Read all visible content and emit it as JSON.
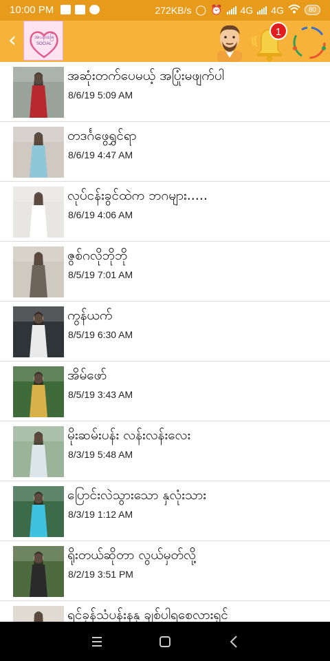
{
  "status_bar": {
    "time": "10:00 PM",
    "speed": "272KB/s",
    "network_1": "4G",
    "network_2": "4G",
    "battery": "80"
  },
  "app_bar": {
    "logo_title": "အပန်းဖြေ",
    "logo_subtitle": "SOCIAL",
    "notification_count": "1"
  },
  "feed": [
    {
      "title": "အဆုံးတက်ပေမယ့် အပြုံးမဖျက်ပါ",
      "time": "8/6/19 5:09 AM",
      "thumb": {
        "bg": "#9aa39a",
        "figure": "#b8282f"
      }
    },
    {
      "title": "တဒင်္ဂဖွေရွှင်ရာ",
      "time": "8/6/19 4:47 AM",
      "thumb": {
        "bg": "#cfc9c2",
        "figure": "#8fc6d8"
      }
    },
    {
      "title": "လုပ်ငန်းခွင်ထဲက ဘဂများ.....",
      "time": "8/6/19 4:06 AM",
      "thumb": {
        "bg": "#e8e6e2",
        "figure": "#ffffff"
      }
    },
    {
      "title": "ဇွစ်ဂလိုဘိုဘို",
      "time": "8/5/19 7:01 AM",
      "thumb": {
        "bg": "#cfcac0",
        "figure": "#6e655a"
      }
    },
    {
      "title": "ကွန်ယက်",
      "time": "8/5/19 6:30 AM",
      "thumb": {
        "bg": "#2f3438",
        "figure": "#e9e9e9"
      }
    },
    {
      "title": "အိမ်ဖော်",
      "time": "8/5/19 3:43 AM",
      "thumb": {
        "bg": "#3f6a3a",
        "figure": "#d9b14a"
      }
    },
    {
      "title": "မိုးဆမ်းပန်း လန်းလန်းလေး",
      "time": "8/3/19 5:48 AM",
      "thumb": {
        "bg": "#9ab49a",
        "figure": "#dce6ea"
      }
    },
    {
      "title": "ပြောင်းလဲသွားသော နှလုံးသား",
      "time": "8/3/19 1:12 AM",
      "thumb": {
        "bg": "#3c6b4a",
        "figure": "#3ec2e0"
      }
    },
    {
      "title": "ရိုးတယ်ဆိုတာ လွယ်မှတ်လို့",
      "time": "8/2/19 3:51 PM",
      "thumb": {
        "bg": "#4d6b3e",
        "figure": "#2a2a2a"
      }
    },
    {
      "title": "ရင်ခုန်သံပန်းနနှ ချစ်ပါရစေလားရှင်",
      "time": "",
      "thumb": {
        "bg": "#d8d2c8",
        "figure": "#a89a88"
      }
    }
  ]
}
